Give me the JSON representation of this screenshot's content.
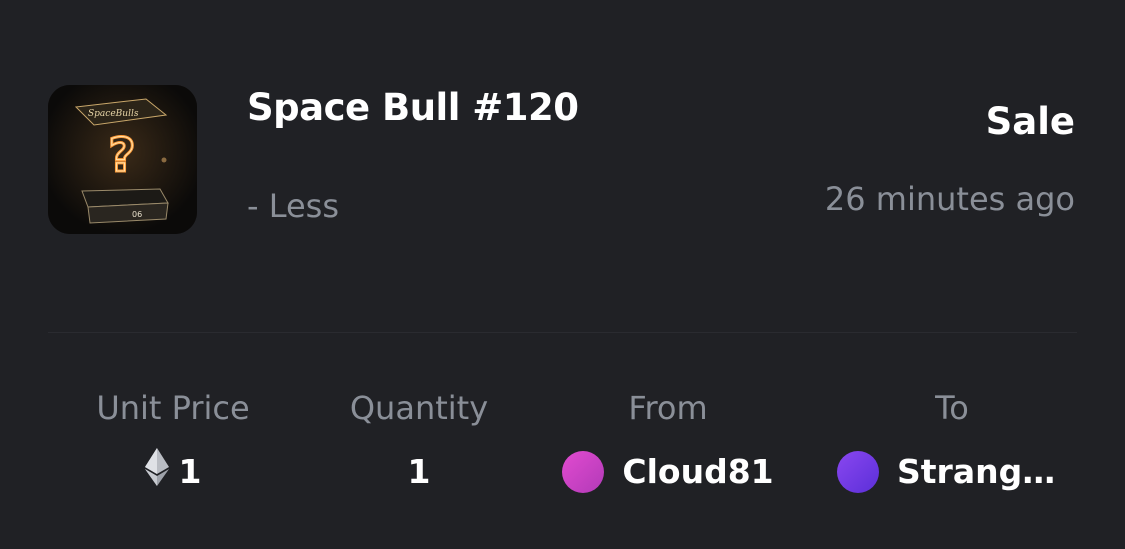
{
  "item": {
    "title": "Space Bull #120",
    "toggle_label": "- Less",
    "thumbnail_icon": "mystery-box-thumbnail"
  },
  "event": {
    "type": "Sale",
    "time": "26 minutes ago"
  },
  "details": {
    "unit_price_label": "Unit Price",
    "unit_price_value": "1",
    "currency_icon": "ethereum-icon",
    "quantity_label": "Quantity",
    "quantity_value": "1",
    "from_label": "From",
    "from_name": "Cloud81",
    "to_label": "To",
    "to_name": "Strange..."
  },
  "colors": {
    "background": "#202125",
    "muted_text": "#8a8f98",
    "from_avatar_a": "#e24bd0",
    "from_avatar_b": "#b23ab8",
    "to_avatar_a": "#8a47f0",
    "to_avatar_b": "#5b2fd8",
    "thumb_glow": "#f2a24a"
  }
}
